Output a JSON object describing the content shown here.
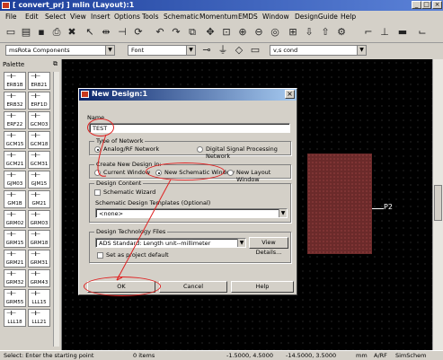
{
  "window": {
    "title": "[ convert_prj ] mlin (Layout):1"
  },
  "menu": [
    "File",
    "Edit",
    "Select",
    "View",
    "Insert",
    "Options",
    "Tools",
    "Schematic",
    "Momentum",
    "EMDS",
    "Window",
    "DesignGuide",
    "Help"
  ],
  "toolbar2": {
    "library": "msRota Components",
    "font": "Font",
    "layer": "v,s cond"
  },
  "palette": {
    "title": "Palette",
    "items": [
      "ERB1B",
      "ERB21",
      "ERB32",
      "ERF1D",
      "ERF22",
      "GCM03",
      "GCM15",
      "GCM18",
      "GCM21",
      "GCM31",
      "GJM03",
      "GJM15",
      "GM1B",
      "GM21",
      "GRM02",
      "GRM03",
      "GRM15",
      "GRM18",
      "GRM21",
      "GRM31",
      "GRM32",
      "GRM43",
      "GRM55",
      "LLL15",
      "LLL18",
      "LLL21"
    ]
  },
  "canvas": {
    "port_label": "P2"
  },
  "dialog": {
    "title": "New Design:1",
    "name_label": "Name",
    "name_value": "TEST",
    "network_group": "Type of Network",
    "network_options": [
      "Analog/RF Network",
      "Digital Signal Processing Network"
    ],
    "network_selected": 0,
    "create_group": "Create New Design in:",
    "create_options": [
      "Current Window",
      "New Schematic Window",
      "New Layout Window"
    ],
    "create_selected": 1,
    "content_group": "Design Content",
    "wizard_label": "Schematic Wizard",
    "templates_label": "Schematic Design Templates (Optional)",
    "templates_value": "<none>",
    "tech_group": "Design Technology Files",
    "tech_value": "ADS Standard: Length unit--millimeter",
    "view_details": "View Details...",
    "set_default": "Set as project default",
    "ok": "OK",
    "cancel": "Cancel",
    "help": "Help"
  },
  "status": {
    "message": "Select: Enter the starting point",
    "items": "0 items",
    "coord1": "-1.5000, 4.5000",
    "coord2": "-14.5000, 3.5000",
    "units": "mm",
    "mode": "A/RF",
    "sim": "SimSchem"
  },
  "colors": {
    "titlebar": "#1d3f9a",
    "dialog_title": "#0a246a",
    "annotation": "#e02020",
    "component": "#6b2a2a"
  }
}
